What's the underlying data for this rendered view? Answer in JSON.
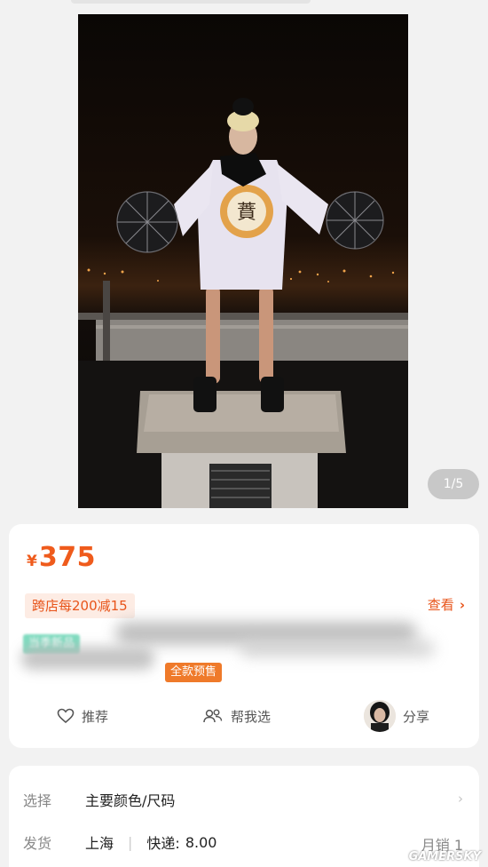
{
  "gallery": {
    "current": "1",
    "total": "5",
    "separator": "/"
  },
  "price": {
    "currency": "¥",
    "amount": "375"
  },
  "promo": {
    "label": "跨店每200减15",
    "view_label": "查看"
  },
  "tags": {
    "season": "当季新品",
    "presale": "全款预售"
  },
  "actions": {
    "recommend": "推荐",
    "help_choose": "帮我选",
    "share": "分享"
  },
  "spec": {
    "select_label": "选择",
    "select_value": "主要颜色/尺码",
    "ship_label": "发货",
    "ship_from": "上海",
    "express_label": "快递:",
    "express_fee": "8.00",
    "monthly_sales_label": "月销",
    "monthly_sales": "1"
  },
  "watermark": "GAMERSKY",
  "colors": {
    "accent": "#ef5b1c",
    "presale": "#ef7a2a",
    "season": "#5fd3b0"
  },
  "icons": [
    "heart-icon",
    "people-icon",
    "chevron-right-icon",
    "avatar"
  ]
}
